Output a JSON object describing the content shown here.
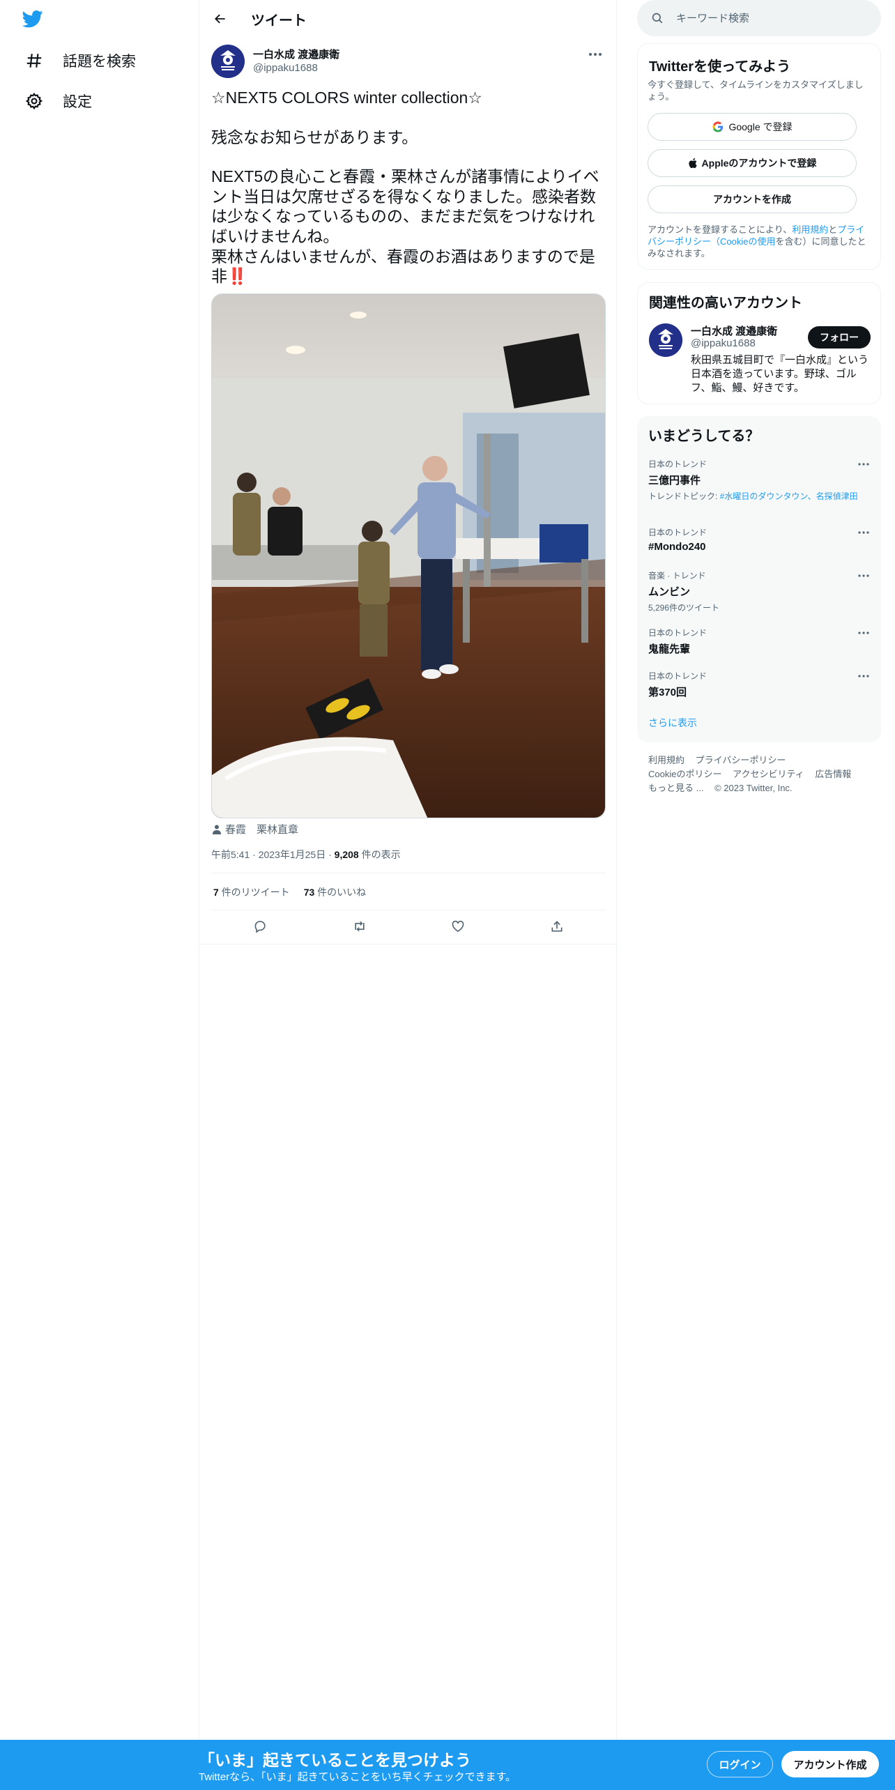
{
  "nav": {
    "items": [
      {
        "label": "話題を検索",
        "icon": "hashtag-icon"
      },
      {
        "label": "設定",
        "icon": "gear-icon"
      }
    ]
  },
  "header": {
    "title": "ツイート"
  },
  "tweet": {
    "author_name": "一白水成 渡邉康衛",
    "author_handle": "@ippaku1688",
    "text_lines": [
      "☆NEXT5 COLORS winter collection☆",
      "残念なお知らせがあります。",
      "NEXT5の良心こと春霞・栗林さんが諸事情によりイベント当日は欠席せざるを得なくなりました。感染者数は少なくなっているものの、まだまだ気をつけなければいけませんね。",
      "栗林さんはいませんが、春霞のお酒はありますので是非"
    ],
    "emphasis": "‼️",
    "tagged_people": "春霞　栗林直章",
    "time": "午前5:41",
    "date": "2023年1月25日",
    "views_count": "9,208",
    "views_label": "件の表示",
    "retweets_count": "7",
    "retweets_label": "件のリツイート",
    "likes_count": "73",
    "likes_label": "件のいいね"
  },
  "search": {
    "placeholder": "キーワード検索"
  },
  "signup_card": {
    "title": "Twitterを使ってみよう",
    "subtitle": "今すぐ登録して、タイムラインをカスタマイズしましょう。",
    "google_label": "Google で登録",
    "apple_label": "Appleのアカウントで登録",
    "create_label": "アカウントを作成",
    "legal_prefix": "アカウントを登録することにより、",
    "legal_terms": "利用規約",
    "legal_and": "と",
    "legal_privacy": "プライバシーポリシー",
    "legal_cookie": "（Cookieの使用",
    "legal_suffix": "を含む）に同意したとみなされます。"
  },
  "related": {
    "title": "関連性の高いアカウント",
    "name": "一白水成 渡邉康衛",
    "handle": "@ippaku1688",
    "bio": "秋田県五城目町で『一白水成』という日本酒を造っています。野球、ゴルフ、鮨、鰻、好きです。",
    "follow_label": "フォロー"
  },
  "trends": {
    "title": "いまどうしてる？",
    "items": [
      {
        "context": "日本のトレンド",
        "name": "三億円事件",
        "extra_label": "トレンドトピック: ",
        "extra_link": "#水曜日のダウンタウン、名探偵津田"
      },
      {
        "context": "日本のトレンド",
        "name": "#Mondo240"
      },
      {
        "context": "音楽 · トレンド",
        "name": "ムンビン",
        "extra_label": "5,296件のツイート"
      },
      {
        "context": "日本のトレンド",
        "name": "鬼龍先輩"
      },
      {
        "context": "日本のトレンド",
        "name": "第370回"
      }
    ],
    "show_more": "さらに表示"
  },
  "footer": {
    "links": [
      "利用規約",
      "プライバシーポリシー",
      "Cookieのポリシー",
      "アクセシビリティ",
      "広告情報",
      "もっと見る ..."
    ],
    "copyright": "© 2023 Twitter, Inc."
  },
  "bottom_bar": {
    "title": "「いま」起きていることを見つけよう",
    "subtitle": "Twitterなら、「いま」起きていることをいち早くチェックできます。",
    "login_label": "ログイン",
    "signup_label": "アカウント作成"
  },
  "colors": {
    "accent": "#1d9bf0",
    "text": "#0f1419",
    "secondary": "#536471",
    "avatar_bg": "#22308a"
  }
}
